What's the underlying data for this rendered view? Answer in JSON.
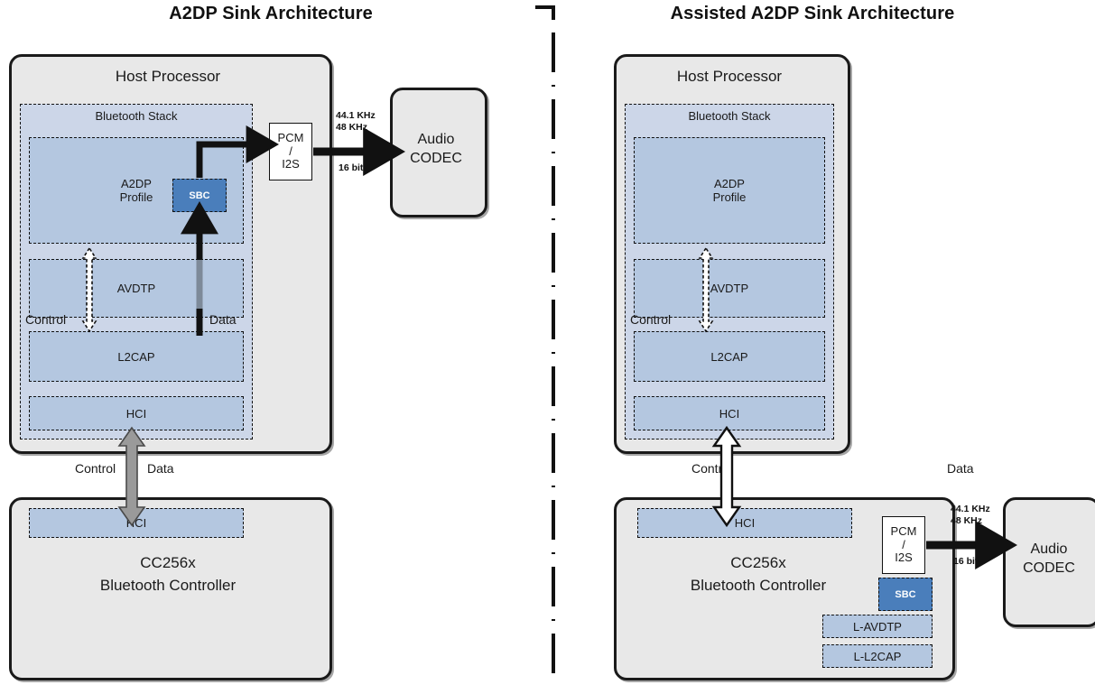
{
  "panels": [
    {
      "id": "left",
      "title": "A2DP Sink Architecture",
      "host": {
        "title": "Host Processor",
        "stack_label": "Bluetooth Stack",
        "layers": [
          {
            "label": "A2DP\nProfile"
          },
          {
            "label": "AVDTP"
          },
          {
            "label": "L2CAP"
          },
          {
            "label": "HCI"
          }
        ],
        "codec_block": "SBC"
      },
      "controller": {
        "hci_label": "HCI",
        "name_line1": "CC256x",
        "name_line2": "Bluetooth Controller",
        "sub_blocks": []
      },
      "pcm": {
        "line1": "PCM",
        "line2": "/",
        "line3": "I2S"
      },
      "audio_codec": {
        "line1": "Audio",
        "line2": "CODEC"
      },
      "notes": {
        "rates": "44.1 KHz\n48 KHz",
        "bits": "16 bits"
      },
      "arrow_labels": {
        "control_stack": "Control",
        "data_stack": "Data",
        "hci_control": "Control",
        "hci_data": "Data"
      }
    },
    {
      "id": "right",
      "title": "Assisted A2DP Sink Architecture",
      "host": {
        "title": "Host Processor",
        "stack_label": "Bluetooth Stack",
        "layers": [
          {
            "label": "A2DP\nProfile"
          },
          {
            "label": "AVDTP"
          },
          {
            "label": "L2CAP"
          },
          {
            "label": "HCI"
          }
        ],
        "codec_block": null
      },
      "controller": {
        "hci_label": "HCI",
        "name_line1": "CC256x",
        "name_line2": "Bluetooth Controller",
        "sub_blocks": [
          "L-AVDTP",
          "L-L2CAP"
        ],
        "codec_block": "SBC"
      },
      "pcm": {
        "line1": "PCM",
        "line2": "/",
        "line3": "I2S"
      },
      "audio_codec": {
        "line1": "Audio",
        "line2": "CODEC"
      },
      "notes": {
        "rates": "44.1 KHz\n48 KHz",
        "bits": "16 bits"
      },
      "arrow_labels": {
        "control_stack": "Control",
        "hci_control": "Control",
        "data_out": "Data"
      }
    }
  ],
  "colors": {
    "chip_fill": "#e8e8e8",
    "stack_fill": "#ccd6e8",
    "layer_fill": "#b4c7e0",
    "sbc_fill": "#4a7ebb",
    "outline": "#1a1a1a",
    "gray_arrow": "#808080"
  }
}
